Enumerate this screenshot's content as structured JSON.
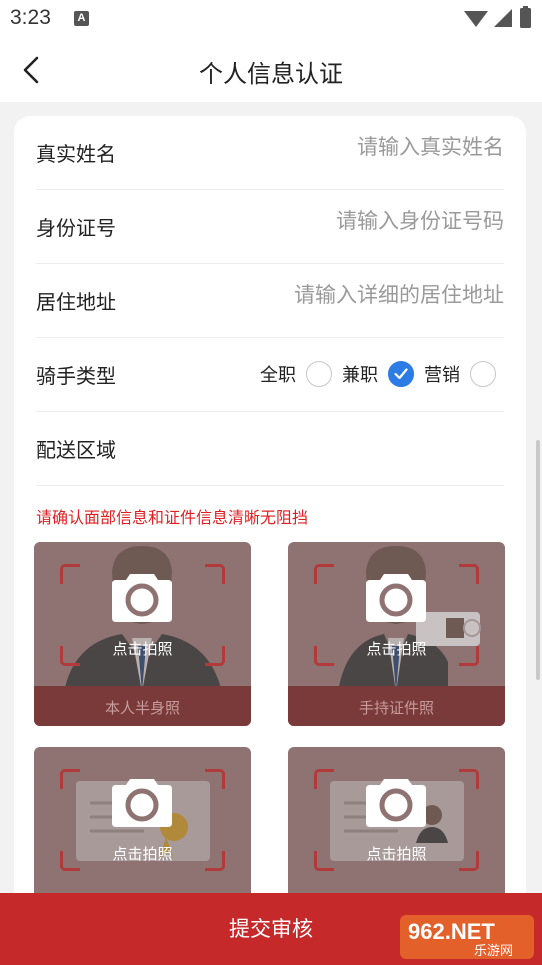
{
  "status_bar": {
    "time": "3:23",
    "a_icon": "A"
  },
  "nav": {
    "title": "个人信息认证"
  },
  "form": {
    "name": {
      "label": "真实姓名",
      "placeholder": "请输入真实姓名"
    },
    "id_number": {
      "label": "身份证号",
      "placeholder": "请输入身份证号码"
    },
    "address": {
      "label": "居住地址",
      "placeholder": "请输入详细的居住地址"
    },
    "rider_type": {
      "label": "骑手类型",
      "options": [
        {
          "label": "全职",
          "checked": false
        },
        {
          "label": "兼职",
          "checked": true
        },
        {
          "label": "营销",
          "checked": false
        }
      ]
    },
    "area": {
      "label": "配送区域"
    }
  },
  "notice": "请确认面部信息和证件信息清晰无阻挡",
  "photos": [
    {
      "tap": "点击拍照",
      "caption": "本人半身照"
    },
    {
      "tap": "点击拍照",
      "caption": "手持证件照"
    },
    {
      "tap": "点击拍照"
    },
    {
      "tap": "点击拍照"
    }
  ],
  "submit_label": "提交审核",
  "watermark": {
    "brand": "962.NET",
    "sub": "乐游网"
  },
  "colors": {
    "accent": "#c62929",
    "check": "#2d7be5",
    "notice": "#e02020"
  }
}
